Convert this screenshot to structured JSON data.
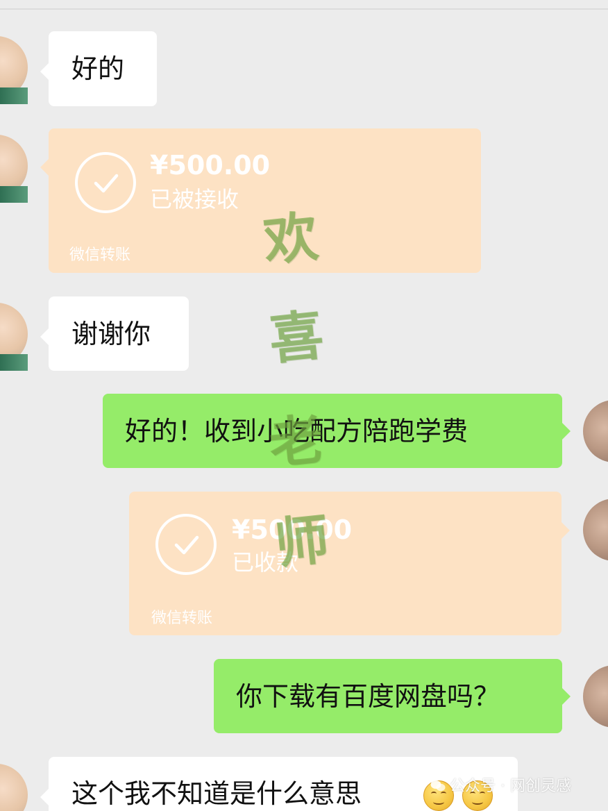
{
  "messages": [
    {
      "side": "left",
      "type": "text",
      "text": "好的"
    },
    {
      "side": "left",
      "type": "transfer",
      "amount": "¥500.00",
      "status": "已被接收",
      "footer": "微信转账"
    },
    {
      "side": "left",
      "type": "text",
      "text": "谢谢你"
    },
    {
      "side": "right",
      "type": "text",
      "text": "好的！收到小吃配方陪跑学费"
    },
    {
      "side": "right",
      "type": "transfer",
      "amount": "¥500.00",
      "status": "已收款",
      "footer": "微信转账"
    },
    {
      "side": "right",
      "type": "text",
      "text": "你下载有百度网盘吗？"
    },
    {
      "side": "left",
      "type": "text",
      "text": "这个我不知道是什么意思"
    }
  ],
  "watermark": {
    "chars": [
      "欢",
      "喜",
      "老",
      "师"
    ],
    "color": "#70a540"
  },
  "attribution": {
    "text": "公众号 · 网创灵感"
  },
  "colors": {
    "chat_background": "#ececec",
    "received_bubble": "#ffffff",
    "sent_bubble": "#95ec69",
    "transfer_card": "#fde2c4"
  },
  "icons": {
    "transfer_status": "check-circle-icon",
    "emoji": "hugging-face-emoji-icon"
  }
}
